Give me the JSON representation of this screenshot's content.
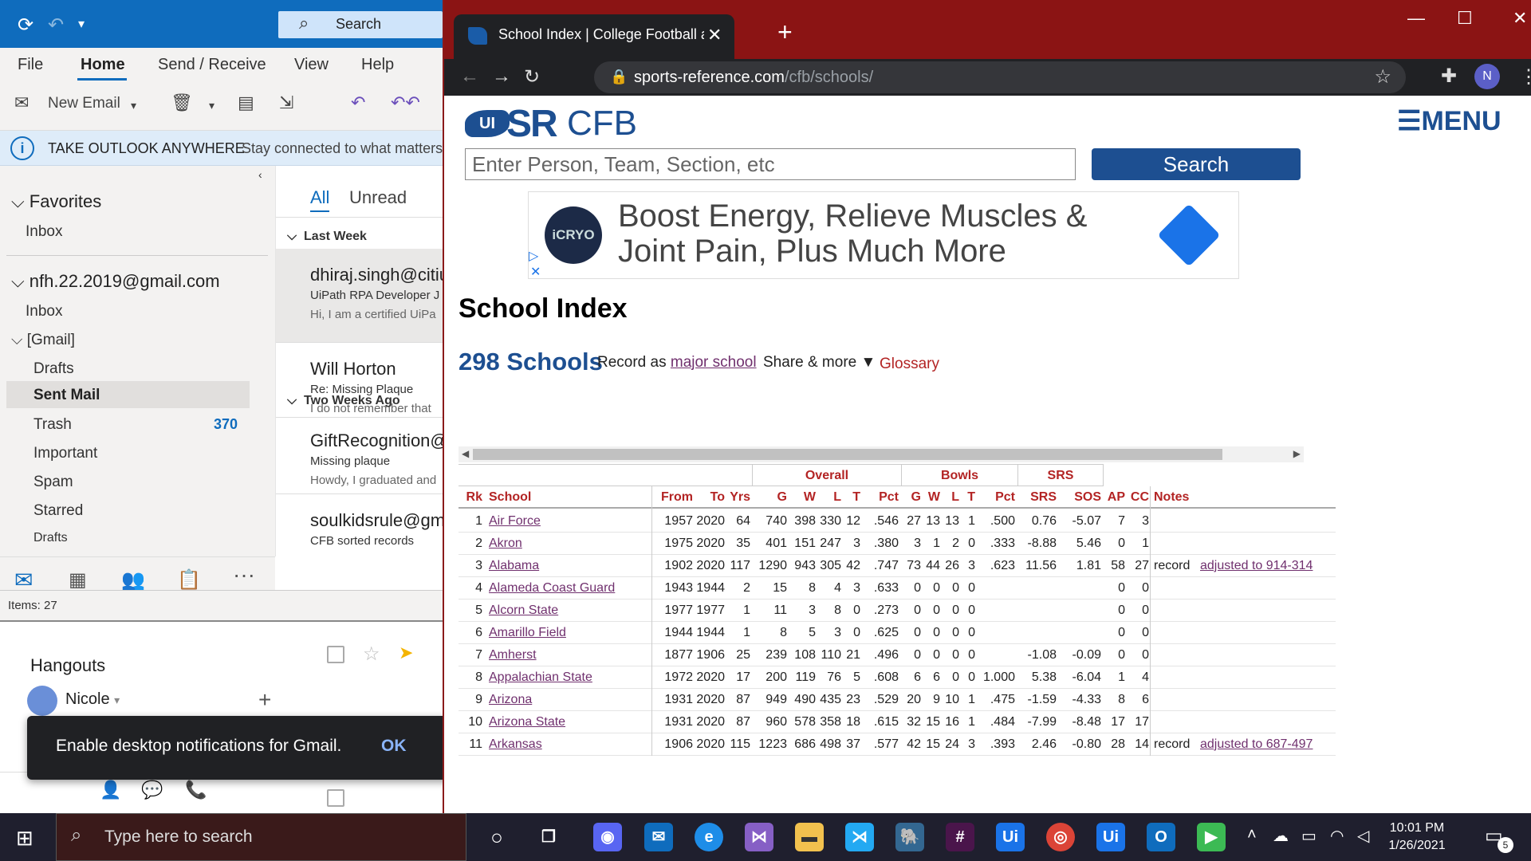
{
  "outlook": {
    "search_placeholder": "Search",
    "menu": [
      "File",
      "Home",
      "Send / Receive",
      "View",
      "Help"
    ],
    "new_email": "New Email",
    "info_title": "TAKE OUTLOOK ANYWHERE",
    "info_text": "Stay connected to what matters",
    "nav": {
      "favorites": "Favorites",
      "fav_inbox": "Inbox",
      "account": "nfh.22.2019@gmail.com",
      "inbox": "Inbox",
      "gmail": "[Gmail]",
      "drafts": "Drafts",
      "sent": "Sent Mail",
      "trash": "Trash",
      "trash_count": "370",
      "important": "Important",
      "spam": "Spam",
      "starred": "Starred",
      "drafts2": "Drafts"
    },
    "list": {
      "tab_all": "All",
      "tab_unread": "Unread",
      "group1": "Last Week",
      "group2": "Two Weeks Ago",
      "messages": [
        {
          "from": "dhiraj.singh@citiu",
          "subject": "UiPath RPA Developer J",
          "preview": "Hi,  I am a certified UiPa"
        },
        {
          "from": "Will Horton",
          "subject": "Re: Missing Plaque",
          "preview": "I do not remember that"
        },
        {
          "from": "GiftRecognition@",
          "subject": "Missing plaque",
          "preview": "Howdy,  I graduated and"
        },
        {
          "from": "soulkidsrule@gm",
          "subject": "CFB sorted records",
          "preview": ""
        }
      ]
    },
    "status": "Items: 27"
  },
  "gmail": {
    "hangouts": "Hangouts",
    "contact": "Nicole",
    "toast": "Enable desktop notifications for Gmail.",
    "ok": "OK"
  },
  "chrome": {
    "tab_title": "School Index | College Football at",
    "url_host": "sports-reference.com",
    "url_path": "/cfb/schools/",
    "profile": "N"
  },
  "site": {
    "logo_ui": "UI",
    "logo_sr": "SR",
    "logo_cfb": "CFB",
    "menu": "☰MENU",
    "search_placeholder": "Enter Person, Team, Section, etc",
    "search_button": "Search",
    "ad_logo": "iCRYO",
    "ad_text": "Boost Energy, Relieve Muscles & Joint Pain, Plus Much More",
    "heading": "School Index",
    "count": "298 Schools",
    "record_as": "Record as ",
    "record_link": "major school",
    "share": "Share & more ▼",
    "glossary": "Glossary"
  },
  "table": {
    "over_headers": [
      "Overall",
      "Bowls",
      "SRS"
    ],
    "headers": [
      "Rk",
      "School",
      "From",
      "To",
      "Yrs",
      "G",
      "W",
      "L",
      "T",
      "Pct",
      "G",
      "W",
      "L",
      "T",
      "Pct",
      "SRS",
      "SOS",
      "AP",
      "CC",
      "Notes"
    ],
    "rows": [
      [
        "1",
        "Air Force",
        "1957",
        "2020",
        "64",
        "740",
        "398",
        "330",
        "12",
        ".546",
        "27",
        "13",
        "13",
        "1",
        ".500",
        "0.76",
        "-5.07",
        "7",
        "3",
        ""
      ],
      [
        "2",
        "Akron",
        "1975",
        "2020",
        "35",
        "401",
        "151",
        "247",
        "3",
        ".380",
        "3",
        "1",
        "2",
        "0",
        ".333",
        "-8.88",
        "5.46",
        "0",
        "1",
        ""
      ],
      [
        "3",
        "Alabama",
        "1902",
        "2020",
        "117",
        "1290",
        "943",
        "305",
        "42",
        ".747",
        "73",
        "44",
        "26",
        "3",
        ".623",
        "11.56",
        "1.81",
        "58",
        "27",
        "adjusted to 914-314"
      ],
      [
        "4",
        "Alameda Coast Guard",
        "1943",
        "1944",
        "2",
        "15",
        "8",
        "4",
        "3",
        ".633",
        "0",
        "0",
        "0",
        "0",
        "",
        "",
        "",
        "0",
        "0",
        ""
      ],
      [
        "5",
        "Alcorn State",
        "1977",
        "1977",
        "1",
        "11",
        "3",
        "8",
        "0",
        ".273",
        "0",
        "0",
        "0",
        "0",
        "",
        "",
        "",
        "0",
        "0",
        ""
      ],
      [
        "6",
        "Amarillo Field",
        "1944",
        "1944",
        "1",
        "8",
        "5",
        "3",
        "0",
        ".625",
        "0",
        "0",
        "0",
        "0",
        "",
        "",
        "",
        "0",
        "0",
        ""
      ],
      [
        "7",
        "Amherst",
        "1877",
        "1906",
        "25",
        "239",
        "108",
        "110",
        "21",
        ".496",
        "0",
        "0",
        "0",
        "0",
        "",
        "-1.08",
        "-0.09",
        "0",
        "0",
        ""
      ],
      [
        "8",
        "Appalachian State",
        "1972",
        "2020",
        "17",
        "200",
        "119",
        "76",
        "5",
        ".608",
        "6",
        "6",
        "0",
        "0",
        "1.000",
        "5.38",
        "-6.04",
        "1",
        "4",
        ""
      ],
      [
        "9",
        "Arizona",
        "1931",
        "2020",
        "87",
        "949",
        "490",
        "435",
        "23",
        ".529",
        "20",
        "9",
        "10",
        "1",
        ".475",
        "-1.59",
        "-4.33",
        "8",
        "6",
        ""
      ],
      [
        "10",
        "Arizona State",
        "1931",
        "2020",
        "87",
        "960",
        "578",
        "358",
        "18",
        ".615",
        "32",
        "15",
        "16",
        "1",
        ".484",
        "-7.99",
        "-8.48",
        "17",
        "17",
        ""
      ],
      [
        "11",
        "Arkansas",
        "1906",
        "2020",
        "115",
        "1223",
        "686",
        "498",
        "37",
        ".577",
        "42",
        "15",
        "24",
        "3",
        ".393",
        "2.46",
        "-0.80",
        "28",
        "14",
        "adjusted to 687-497"
      ]
    ],
    "note_prefix": "record "
  },
  "taskbar": {
    "search_placeholder": "Type here to search",
    "time": "10:01 PM",
    "date": "1/26/2021",
    "notif_count": "5"
  },
  "colors": {
    "outlook_blue": "#0f6cbd",
    "chrome_frame": "#8b1414",
    "sr_blue": "#1d4f91",
    "sr_red": "#b32424",
    "link_purple": "#70306e"
  }
}
